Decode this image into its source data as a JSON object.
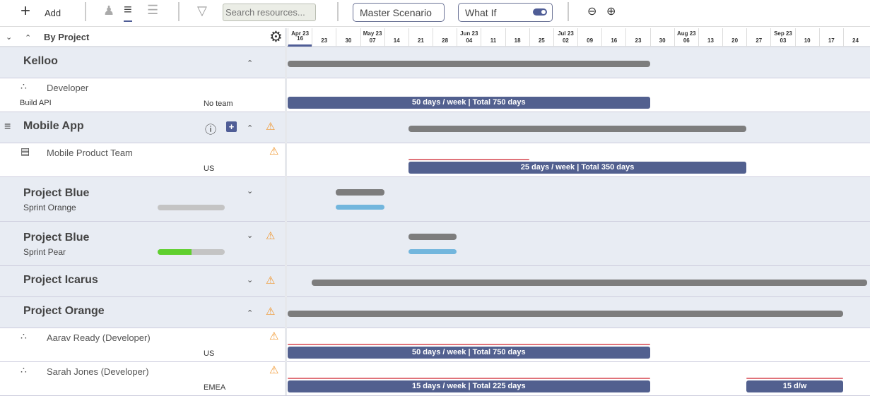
{
  "toolbar": {
    "add_label": "Add",
    "search_placeholder": "Search resources...",
    "scenario": "Master Scenario",
    "what_if": "What If",
    "what_if_on": true
  },
  "header": {
    "group_by": "By Project"
  },
  "timeline": {
    "columns": [
      {
        "month": "Apr 23",
        "day": "16"
      },
      {
        "month": "",
        "day": "23"
      },
      {
        "month": "",
        "day": "30"
      },
      {
        "month": "May 23",
        "day": "07"
      },
      {
        "month": "",
        "day": "14"
      },
      {
        "month": "",
        "day": "21"
      },
      {
        "month": "",
        "day": "28"
      },
      {
        "month": "Jun 23",
        "day": "04"
      },
      {
        "month": "",
        "day": "11"
      },
      {
        "month": "",
        "day": "18"
      },
      {
        "month": "",
        "day": "25"
      },
      {
        "month": "Jul 23",
        "day": "02"
      },
      {
        "month": "",
        "day": "09"
      },
      {
        "month": "",
        "day": "16"
      },
      {
        "month": "",
        "day": "23"
      },
      {
        "month": "",
        "day": "30"
      },
      {
        "month": "Aug 23",
        "day": "06"
      },
      {
        "month": "",
        "day": "13"
      },
      {
        "month": "",
        "day": "20"
      },
      {
        "month": "",
        "day": "27"
      },
      {
        "month": "Sep 23",
        "day": "03"
      },
      {
        "month": "",
        "day": "10"
      },
      {
        "month": "",
        "day": "17"
      },
      {
        "month": "",
        "day": "24"
      }
    ]
  },
  "rows": [
    {
      "type": "group",
      "title": "Kelloo",
      "chevron": "up",
      "bars": [
        {
          "kind": "gray",
          "start": 0,
          "end": 15
        }
      ]
    },
    {
      "type": "child",
      "icon": "resource-group-icon",
      "title": "Developer",
      "task": "Build API",
      "team": "No team",
      "bars": [
        {
          "kind": "blue",
          "start": 0,
          "end": 15,
          "label": "50 days / week | Total 750 days"
        }
      ]
    },
    {
      "type": "group",
      "title": "Mobile App",
      "chevron": "up",
      "warning": true,
      "menu": true,
      "info": true,
      "add": true,
      "bars": [
        {
          "kind": "gray",
          "start": 5,
          "end": 19
        }
      ]
    },
    {
      "type": "child",
      "icon": "team-icon",
      "title": "Mobile Product Team",
      "team": "US",
      "warning": true,
      "bars": [
        {
          "kind": "red",
          "start": 5,
          "end": 10
        },
        {
          "kind": "blue",
          "start": 5,
          "end": 19,
          "label": "25 days / week | Total 350 days"
        }
      ]
    },
    {
      "type": "group",
      "title": "Project Blue",
      "subtitle": "Sprint Orange",
      "progress": 0,
      "chevron": "down",
      "bars": [
        {
          "kind": "gray",
          "start": 2,
          "end": 4
        },
        {
          "kind": "lblue",
          "start": 2,
          "end": 4
        }
      ]
    },
    {
      "type": "group",
      "title": "Project Blue",
      "subtitle": "Sprint Pear",
      "progress": 50,
      "chevron": "down",
      "warning": true,
      "bars": [
        {
          "kind": "gray",
          "start": 5,
          "end": 7
        },
        {
          "kind": "lblue",
          "start": 5,
          "end": 7
        }
      ]
    },
    {
      "type": "group",
      "title": "Project Icarus",
      "chevron": "down",
      "warning": true,
      "bars": [
        {
          "kind": "gray",
          "start": 1,
          "end": 24
        }
      ]
    },
    {
      "type": "group",
      "title": "Project Orange",
      "chevron": "up",
      "warning": true,
      "bars": [
        {
          "kind": "gray",
          "start": 0,
          "end": 23
        }
      ]
    },
    {
      "type": "child",
      "icon": "resource-group-icon",
      "title": "Aarav Ready (Developer)",
      "team": "US",
      "warning": true,
      "bars": [
        {
          "kind": "red",
          "start": 0,
          "end": 15
        },
        {
          "kind": "blue",
          "start": 0,
          "end": 15,
          "label": "50 days / week | Total 750 days"
        }
      ]
    },
    {
      "type": "child",
      "icon": "resource-group-icon",
      "title": "Sarah Jones (Developer)",
      "team": "EMEA",
      "warning": true,
      "bars": [
        {
          "kind": "red",
          "start": 0,
          "end": 15
        },
        {
          "kind": "blue",
          "start": 0,
          "end": 15,
          "label": "15 days / week | Total 225 days"
        },
        {
          "kind": "red",
          "start": 19,
          "end": 23
        },
        {
          "kind": "blue",
          "start": 19,
          "end": 23,
          "label": "15 d/w"
        }
      ]
    }
  ]
}
